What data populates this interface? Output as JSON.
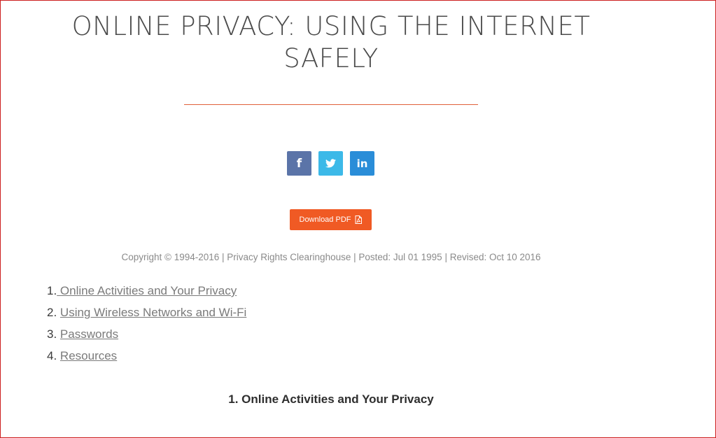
{
  "article": {
    "title": "ONLINE PRIVACY: USING THE INTERNET SAFELY",
    "download_label": "Download PDF",
    "meta": "Copyright © 1994-2016 | Privacy Rights Clearinghouse | Posted: Jul 01 1995  | Revised: Oct 10 2016",
    "section_heading": "1.  Online Activities and Your Privacy"
  },
  "share": {
    "facebook_glyph": "f",
    "linkedin_glyph": "in",
    "icons": [
      "facebook-icon",
      "twitter-icon",
      "linkedin-icon"
    ]
  },
  "toc": [
    {
      "num": "1.",
      "label": " Online Activities and Your Privacy"
    },
    {
      "num": "2.",
      "label": "Using Wireless Networks and Wi-Fi"
    },
    {
      "num": "3.",
      "label": "Passwords"
    },
    {
      "num": "4.",
      "label": "Resources"
    }
  ],
  "colors": {
    "accent": "#f05a24",
    "facebook": "#5b74a8",
    "twitter": "#3cb9e8",
    "linkedin": "#2a8dd8"
  }
}
